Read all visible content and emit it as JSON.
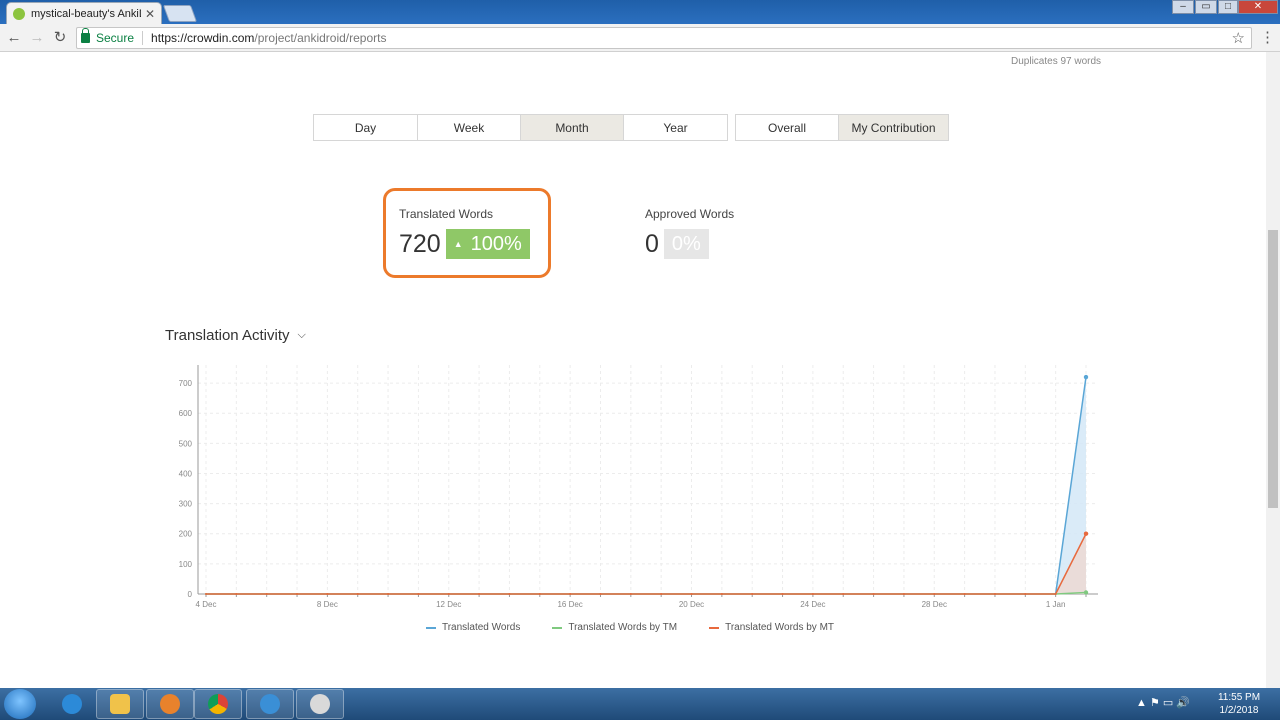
{
  "browser": {
    "tab_title": "mystical-beauty's AnkiDr",
    "tab_close": "✕",
    "secure_label": "Secure",
    "url_host": "https://crowdin.com",
    "url_path": "/project/ankidroid/reports",
    "icons": [
      "back-icon",
      "forward-icon",
      "reload-icon",
      "lock-icon",
      "star-icon",
      "menu-icon"
    ]
  },
  "page": {
    "duplicates": "Duplicates 97 words",
    "period_tabs": [
      "Day",
      "Week",
      "Month",
      "Year"
    ],
    "period_active": "Month",
    "scope_tabs": [
      "Overall",
      "My Contribution"
    ],
    "scope_active": "My Contribution",
    "stats": {
      "translated": {
        "label": "Translated Words",
        "value": "720",
        "badge": "100%"
      },
      "approved": {
        "label": "Approved Words",
        "value": "0",
        "badge": "0%"
      }
    },
    "section_title": "Translation Activity"
  },
  "chart_data": {
    "type": "area",
    "title": "Translation Activity",
    "xlabel": "",
    "ylabel": "",
    "ylim": [
      0,
      760
    ],
    "yticks": [
      0,
      100,
      200,
      300,
      400,
      500,
      600,
      700
    ],
    "x_tick_labels": [
      "4 Dec",
      "8 Dec",
      "12 Dec",
      "16 Dec",
      "20 Dec",
      "24 Dec",
      "28 Dec",
      "1 Jan"
    ],
    "x": [
      "4 Dec",
      "5 Dec",
      "6 Dec",
      "7 Dec",
      "8 Dec",
      "9 Dec",
      "10 Dec",
      "11 Dec",
      "12 Dec",
      "13 Dec",
      "14 Dec",
      "15 Dec",
      "16 Dec",
      "17 Dec",
      "18 Dec",
      "19 Dec",
      "20 Dec",
      "21 Dec",
      "22 Dec",
      "23 Dec",
      "24 Dec",
      "25 Dec",
      "26 Dec",
      "27 Dec",
      "28 Dec",
      "29 Dec",
      "30 Dec",
      "31 Dec",
      "1 Jan",
      "2 Jan"
    ],
    "series": [
      {
        "name": "Translated Words",
        "color": "#5aa6d6",
        "fill": "#d4e8f7",
        "values": [
          0,
          0,
          0,
          0,
          0,
          0,
          0,
          0,
          0,
          0,
          0,
          0,
          0,
          0,
          0,
          0,
          0,
          0,
          0,
          0,
          0,
          0,
          0,
          0,
          0,
          0,
          0,
          0,
          0,
          720
        ]
      },
      {
        "name": "Translated Words by TM",
        "color": "#7fc97f",
        "fill": null,
        "values": [
          0,
          0,
          0,
          0,
          0,
          0,
          0,
          0,
          0,
          0,
          0,
          0,
          0,
          0,
          0,
          0,
          0,
          0,
          0,
          0,
          0,
          0,
          0,
          0,
          0,
          0,
          0,
          0,
          0,
          5
        ]
      },
      {
        "name": "Translated Words by MT",
        "color": "#e8693d",
        "fill": "#ecd9d4",
        "values": [
          0,
          0,
          0,
          0,
          0,
          0,
          0,
          0,
          0,
          0,
          0,
          0,
          0,
          0,
          0,
          0,
          0,
          0,
          0,
          0,
          0,
          0,
          0,
          0,
          0,
          0,
          0,
          0,
          0,
          200
        ]
      }
    ],
    "grid": true,
    "legend_position": "bottom-center"
  },
  "taskbar": {
    "apps": [
      "ie-icon",
      "explorer-icon",
      "media-player-icon",
      "chrome-icon",
      "sync-icon",
      "paint-icon"
    ],
    "tray_icons": "▲  ⚑  ▭  🔊",
    "time": "11:55 PM",
    "date": "1/2/2018"
  }
}
